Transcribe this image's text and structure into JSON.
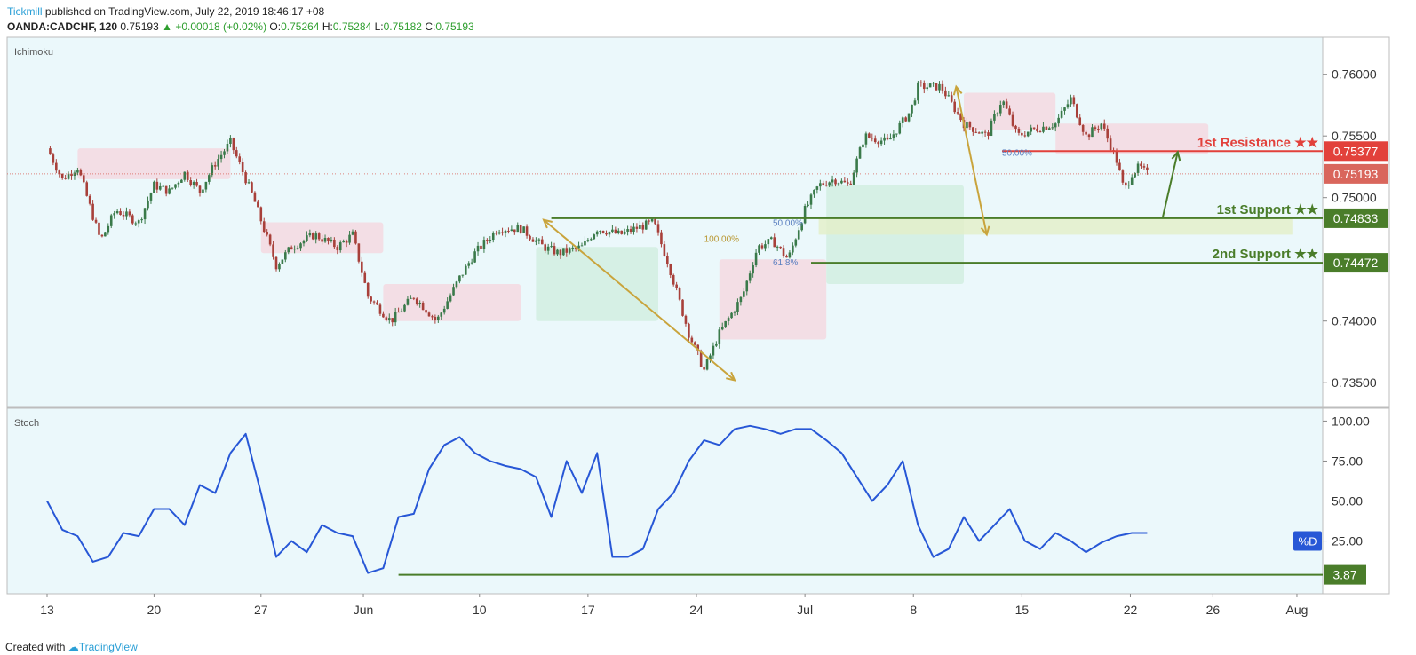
{
  "header": {
    "brand": "Tickmill",
    "published": "published on TradingView.com, July 22, 2019 18:46:17 +08",
    "symbol": "OANDA:CADCHF, 120",
    "last": "0.75193",
    "change": "+0.00018 (+0.02%)",
    "o_label": "O:",
    "o": "0.75264",
    "h_label": "H:",
    "h": "0.75284",
    "l_label": "L:",
    "l": "0.75182",
    "c_label": "C:",
    "c": "0.75193"
  },
  "footer": {
    "created_with": "Created with",
    "tv": "TradingView"
  },
  "colors": {
    "pane_bg": "#ebf8fb",
    "candle_up": "#3a7a4a",
    "candle_down": "#a8403a",
    "stoch_line": "#2757d6",
    "support": "#4a7d2a",
    "resistance": "#e2413b",
    "current_price": "#d9665c",
    "arrow": "#c9a43c"
  },
  "chart_data": [
    {
      "type": "candlestick",
      "pane_label": "Ichimoku",
      "ylim": [
        0.733,
        0.763
      ],
      "y_ticks": [
        "0.76000",
        "0.75500",
        "0.75000",
        "0.74000",
        "0.73500"
      ],
      "y_tick_values": [
        0.76,
        0.755,
        0.75,
        0.74,
        0.735
      ],
      "x_tick_labels": [
        "13",
        "20",
        "27",
        "Jun",
        "10",
        "17",
        "24",
        "Jul",
        "8",
        "15",
        "22",
        "26",
        "Aug"
      ],
      "x_tick_positions": [
        0.0,
        7.0,
        14.0,
        20.7,
        28.3,
        35.4,
        42.5,
        49.6,
        56.7,
        63.8,
        70.9,
        76.3,
        81.8
      ],
      "path_x": [
        0,
        1,
        2,
        3.5,
        4.5,
        6,
        7,
        8,
        9,
        10,
        11,
        12,
        13.5,
        15,
        16,
        17.5,
        19,
        20,
        21,
        22.5,
        24,
        25.5,
        27,
        28,
        29.5,
        31,
        32.5,
        33.5,
        35,
        36,
        37.5,
        38.5,
        39.7,
        40.7,
        42,
        43,
        44,
        45.5,
        46.5,
        47.5,
        48.5,
        49.6,
        50.5,
        51.5,
        52.5,
        53.5,
        55,
        56.5,
        57,
        58.5,
        60,
        61.5,
        62.5,
        63.5,
        64.5,
        66,
        67,
        68,
        69,
        70,
        70.5,
        71,
        71.5,
        72
      ],
      "path_close": [
        0.754,
        0.7515,
        0.7525,
        0.7465,
        0.749,
        0.748,
        0.751,
        0.7505,
        0.752,
        0.7505,
        0.7528,
        0.7545,
        0.75,
        0.7445,
        0.746,
        0.747,
        0.746,
        0.747,
        0.742,
        0.74,
        0.742,
        0.74,
        0.7435,
        0.7455,
        0.7475,
        0.7475,
        0.746,
        0.7455,
        0.746,
        0.7475,
        0.747,
        0.7475,
        0.748,
        0.7445,
        0.739,
        0.736,
        0.739,
        0.742,
        0.746,
        0.7465,
        0.745,
        0.749,
        0.751,
        0.7515,
        0.751,
        0.755,
        0.7545,
        0.757,
        0.759,
        0.759,
        0.756,
        0.755,
        0.758,
        0.755,
        0.7555,
        0.756,
        0.758,
        0.755,
        0.756,
        0.753,
        0.7505,
        0.752,
        0.7525,
        0.7519
      ],
      "ichimoku_cloud": [
        {
          "x0": 2,
          "x1": 12,
          "top": 0.754,
          "bottom": 0.7515,
          "color": "pink"
        },
        {
          "x0": 14,
          "x1": 22,
          "top": 0.748,
          "bottom": 0.7455,
          "color": "pink"
        },
        {
          "x0": 22,
          "x1": 31,
          "top": 0.743,
          "bottom": 0.74,
          "color": "pink"
        },
        {
          "x0": 32,
          "x1": 40,
          "top": 0.746,
          "bottom": 0.74,
          "color": "green"
        },
        {
          "x0": 44,
          "x1": 51,
          "top": 0.745,
          "bottom": 0.7385,
          "color": "pink"
        },
        {
          "x0": 51,
          "x1": 60,
          "top": 0.751,
          "bottom": 0.743,
          "color": "green"
        },
        {
          "x0": 60,
          "x1": 66,
          "top": 0.7585,
          "bottom": 0.7555,
          "color": "pink"
        },
        {
          "x0": 66,
          "x1": 76,
          "top": 0.756,
          "bottom": 0.7535,
          "color": "pink"
        }
      ],
      "levels": [
        {
          "name": "1st Resistance ★★",
          "value": 0.75377,
          "label": "0.75377",
          "role": "resistance",
          "x_start": 62.5
        },
        {
          "name": "1st Support ★★",
          "value": 0.74833,
          "label": "0.74833",
          "role": "support",
          "x_start": 33.0
        },
        {
          "name": "2nd Support ★★",
          "value": 0.74472,
          "label": "0.74472",
          "role": "support",
          "x_start": 50.0
        }
      ],
      "current_price": {
        "value": 0.75193,
        "label": "0.75193"
      },
      "fib_labels": [
        {
          "text": "50.00%",
          "x": 62.5,
          "y": 0.7537
        },
        {
          "text": "50.00%",
          "x": 47.5,
          "y": 0.748
        },
        {
          "text": "100.00%",
          "x": 43.0,
          "y": 0.7467
        },
        {
          "text": "61.8%",
          "x": 47.5,
          "y": 0.7448
        }
      ],
      "support_zone": {
        "x0": 50.5,
        "x1": 81.5,
        "top": 0.74833,
        "bottom": 0.747
      },
      "arrows": [
        {
          "x0": 32.5,
          "y0": 0.7482,
          "x1": 45.0,
          "y1": 0.7352,
          "heads": "both",
          "role": "arrow"
        },
        {
          "x0": 59.5,
          "y0": 0.759,
          "x1": 61.5,
          "y1": 0.747,
          "heads": "both",
          "role": "arrow"
        },
        {
          "x0": 73.0,
          "y0": 0.7483,
          "x1": 74.0,
          "y1": 0.7537,
          "heads": "end",
          "role": "support"
        }
      ]
    },
    {
      "type": "line",
      "pane_label": "Stoch",
      "series_label": "%D",
      "ylim": [
        -8,
        108
      ],
      "y_ticks": [
        "100.00",
        "75.00",
        "50.00",
        "25.00"
      ],
      "y_tick_values": [
        100,
        75,
        50,
        25
      ],
      "level": {
        "value": 3.87,
        "label": "3.87",
        "x_start": 23.0
      },
      "x": [
        0,
        1,
        2,
        3,
        4,
        5,
        6,
        7,
        8,
        9,
        10,
        11,
        12,
        13,
        14,
        15,
        16,
        17,
        18,
        19,
        20,
        21,
        22,
        23,
        24,
        25,
        26,
        27,
        28,
        29,
        30,
        31,
        32,
        33,
        34,
        35,
        36,
        37,
        38,
        39,
        40,
        41,
        42,
        43,
        44,
        45,
        46,
        47,
        48,
        49,
        50,
        51,
        52,
        53,
        54,
        55,
        56,
        57,
        58,
        59,
        60,
        61,
        62,
        63,
        64,
        65,
        66,
        67,
        68,
        69,
        70,
        71,
        72
      ],
      "values": [
        50,
        32,
        28,
        12,
        15,
        30,
        28,
        45,
        45,
        35,
        60,
        55,
        80,
        92,
        55,
        15,
        25,
        18,
        35,
        30,
        28,
        5,
        8,
        40,
        42,
        70,
        85,
        90,
        80,
        75,
        72,
        70,
        65,
        40,
        75,
        55,
        80,
        15,
        15,
        20,
        45,
        55,
        75,
        88,
        85,
        95,
        97,
        95,
        92,
        95,
        95,
        88,
        80,
        65,
        50,
        60,
        75,
        35,
        15,
        20,
        40,
        25,
        35,
        45,
        25,
        20,
        30,
        25,
        18,
        24,
        28,
        30,
        30
      ]
    }
  ]
}
